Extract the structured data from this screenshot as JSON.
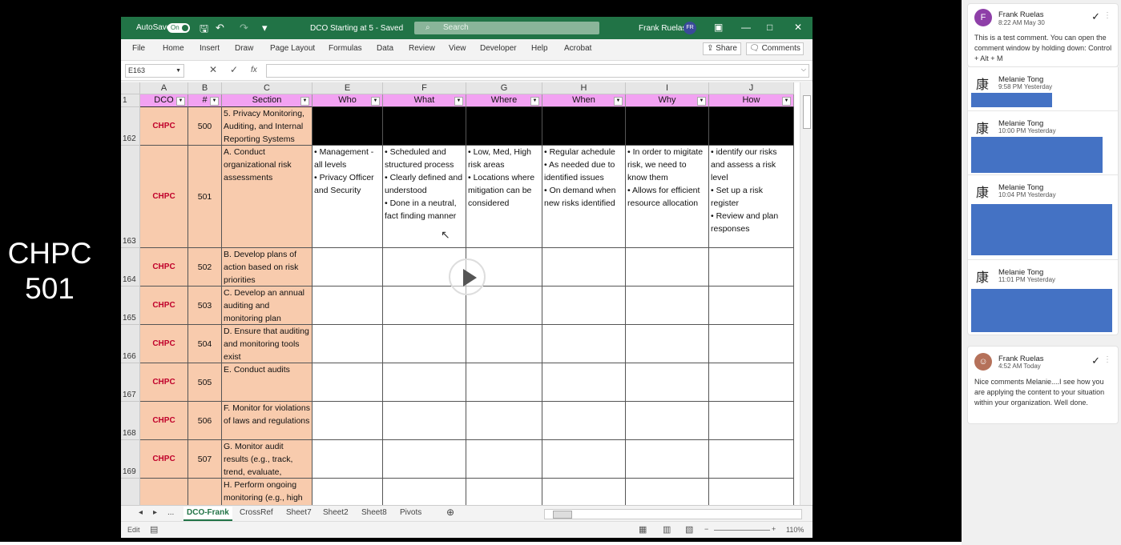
{
  "slide_label": "CHPC\n501",
  "excel": {
    "autosave_label": "AutoSave",
    "autosave_state": "On",
    "doc_title": "DCO Starting at 5 - Saved",
    "search_placeholder": "Search",
    "user_name": "Frank Ruelas",
    "user_initials": "FR",
    "menu": [
      "File",
      "Home",
      "Insert",
      "Draw",
      "Page Layout",
      "Formulas",
      "Data",
      "Review",
      "View",
      "Developer",
      "Help",
      "Acrobat"
    ],
    "share_label": "Share",
    "comments_label": "Comments",
    "name_box": "E163",
    "fx_label": "fx",
    "columns": [
      "A",
      "B",
      "C",
      "E",
      "F",
      "G",
      "H",
      "I",
      "J"
    ],
    "headers": [
      "DCO",
      "#",
      "Section",
      "Who",
      "What",
      "Where",
      "When",
      "Why",
      "How"
    ],
    "rows": [
      {
        "row": "162",
        "dco": "CHPC",
        "num": "500",
        "section": "5. Privacy Monitoring, Auditing, and Internal Reporting Systems",
        "who": "",
        "what": "",
        "where": "",
        "when": "",
        "why": "",
        "how": ""
      },
      {
        "row": "163",
        "dco": "CHPC",
        "num": "501",
        "section": "A. Conduct organizational risk assessments",
        "who": "• Management - all levels\n• Privacy Officer and Security",
        "what": "• Scheduled and structured process\n• Clearly defined and understood\n• Done in a neutral, fact finding manner",
        "where": "• Low, Med, High risk areas\n• Locations where mitigation can be considered",
        "when": "• Regular achedule\n• As needed due to identified issues\n• On demand when new risks identified",
        "why": "• In order to migitate risk, we need to know them\n• Allows for efficient resource allocation",
        "how": "• identify our risks and assess a risk level\n• Set up a risk register\n• Review and plan responses"
      },
      {
        "row": "164",
        "dco": "CHPC",
        "num": "502",
        "section": "B. Develop plans of action based on risk priorities",
        "who": "",
        "what": "",
        "where": "",
        "when": "",
        "why": "",
        "how": ""
      },
      {
        "row": "165",
        "dco": "CHPC",
        "num": "503",
        "section": "C. Develop an annual auditing and monitoring plan",
        "who": "",
        "what": "",
        "where": "",
        "when": "",
        "why": "",
        "how": ""
      },
      {
        "row": "166",
        "dco": "CHPC",
        "num": "504",
        "section": "D. Ensure that auditing and monitoring tools exist",
        "who": "",
        "what": "",
        "where": "",
        "when": "",
        "why": "",
        "how": ""
      },
      {
        "row": "167",
        "dco": "CHPC",
        "num": "505",
        "section": "E. Conduct audits",
        "who": "",
        "what": "",
        "where": "",
        "when": "",
        "why": "",
        "how": ""
      },
      {
        "row": "168",
        "dco": "CHPC",
        "num": "506",
        "section": "F. Monitor for violations of laws and regulations",
        "who": "",
        "what": "",
        "where": "",
        "when": "",
        "why": "",
        "how": ""
      },
      {
        "row": "169",
        "dco": "CHPC",
        "num": "507",
        "section": "G. Monitor audit results (e.g., track, trend, evaluate,",
        "who": "",
        "what": "",
        "where": "",
        "when": "",
        "why": "",
        "how": ""
      },
      {
        "row": "",
        "dco": "",
        "num": "",
        "section": "H. Perform ongoing monitoring (e.g., high",
        "who": "",
        "what": "",
        "where": "",
        "when": "",
        "why": "",
        "how": ""
      }
    ],
    "sheet_tabs": [
      "...",
      "DCO-Frank",
      "CrossRef",
      "Sheet7",
      "Sheet2",
      "Sheet8",
      "Pivots"
    ],
    "active_tab": "DCO-Frank",
    "status_mode": "Edit",
    "zoom": "110%"
  },
  "comments": [
    {
      "author": "Frank Ruelas",
      "time": "8:22 AM May 30",
      "initial": "F",
      "text": "This is a test comment. You can open the comment window by holding down: Control + Alt + M",
      "avatar_color": "#8e3fa8"
    },
    {
      "author": "Melanie Tong",
      "time": "9:58 PM Yesterday",
      "logo": "康"
    },
    {
      "author": "Melanie Tong",
      "time": "10:00 PM Yesterday",
      "logo": "康"
    },
    {
      "author": "Melanie Tong",
      "time": "10:04 PM Yesterday",
      "logo": "康"
    },
    {
      "author": "Melanie Tong",
      "time": "11:01 PM Yesterday",
      "logo": "康"
    },
    {
      "author": "Frank Ruelas",
      "time": "4:52 AM Today",
      "text": "Nice comments Melanie....I see how you are applying the content to your situation within your organization.  Well done."
    }
  ],
  "colors": {
    "excel_green": "#217346",
    "header_pink": "#f2a2f2",
    "peach": "#f8cbad",
    "chpc_red": "#c0002a",
    "comment_blue": "#4472c4"
  }
}
